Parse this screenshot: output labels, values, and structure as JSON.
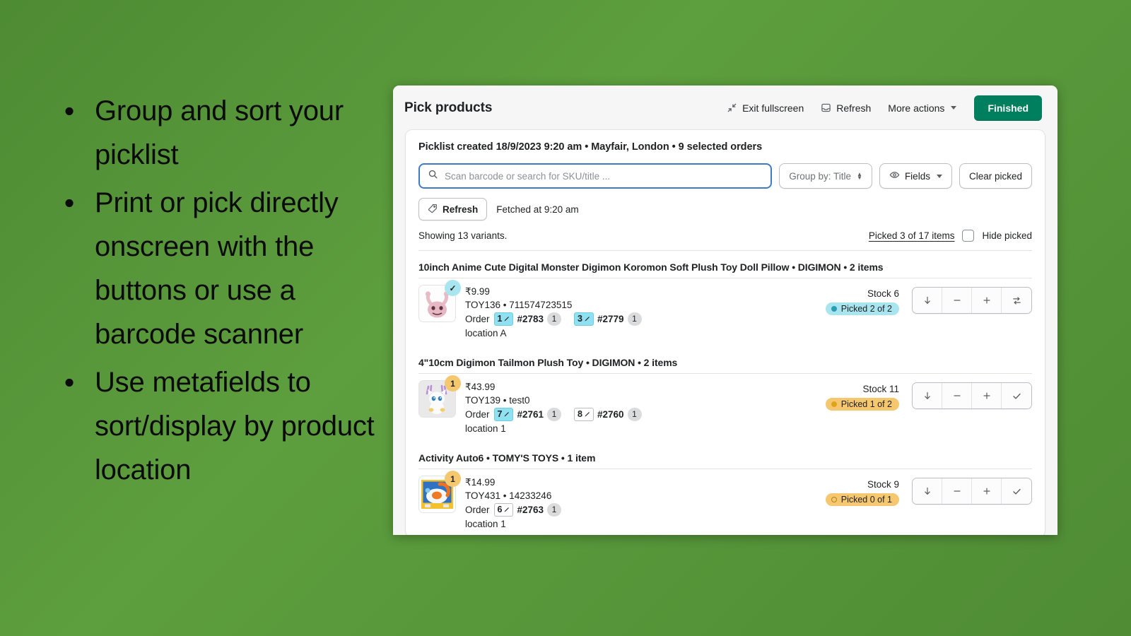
{
  "slide": {
    "bullets": [
      "Group and sort your picklist",
      "Print or pick directly onscreen with the buttons or use a barcode scanner",
      "Use metafields to sort/display by product location"
    ],
    "bullet_marker": "•",
    "background_color": "#55963a"
  },
  "app": {
    "title": "Pick products",
    "header": {
      "exit_fullscreen": "Exit fullscreen",
      "refresh": "Refresh",
      "more_actions": "More actions",
      "finished": "Finished",
      "finished_color": "#007f5f"
    },
    "picklist_meta": "Picklist created 18/9/2023 9:20 am • Mayfair, London • 9 selected orders",
    "search": {
      "placeholder": "Scan barcode or search for SKU/title ...",
      "value": ""
    },
    "group_by": "Group by: Title",
    "fields": "Fields",
    "clear_picked": "Clear picked",
    "refresh_btn": "Refresh",
    "fetched": "Fetched at 9:20 am",
    "showing": "Showing 13 variants.",
    "picked_summary": "Picked 3 of 17 items",
    "hide_picked": "Hide picked",
    "hide_picked_checked": false,
    "groups": [
      {
        "heading": "10inch Anime Cute Digital Monster Digimon Koromon Soft Plush Toy Doll Pillow • DIGIMON • 2 items",
        "rows": [
          {
            "thumb": "koromon",
            "badge": "✓",
            "badge_state": "done",
            "price": "₹9.99",
            "sku": "TOY136 • 711574723515",
            "order_label": "Order",
            "orders": [
              {
                "seq": "1",
                "highlighted": true,
                "number": "#2783",
                "qty": "1"
              },
              {
                "seq": "3",
                "highlighted": true,
                "number": "#2779",
                "qty": "1"
              }
            ],
            "location": "location A",
            "stock": "Stock 6",
            "picked": "Picked 2 of 2",
            "picked_state": "complete",
            "actions": [
              "down-arrow",
              "minus",
              "plus",
              "swap"
            ]
          }
        ]
      },
      {
        "heading": "4\"10cm Digimon Tailmon Plush Toy • DIGIMON • 2 items",
        "rows": [
          {
            "thumb": "tailmon",
            "badge": "1",
            "badge_state": "pending",
            "price": "₹43.99",
            "sku": "TOY139 • test0",
            "order_label": "Order",
            "orders": [
              {
                "seq": "7",
                "highlighted": true,
                "number": "#2761",
                "qty": "1"
              },
              {
                "seq": "8",
                "highlighted": false,
                "number": "#2760",
                "qty": "1"
              }
            ],
            "location": "location 1",
            "stock": "Stock 11",
            "picked": "Picked 1 of 2",
            "picked_state": "partial",
            "actions": [
              "down-arrow",
              "minus",
              "plus",
              "check"
            ]
          }
        ]
      },
      {
        "heading": "Activity Auto6 • TOMY'S TOYS • 1 item",
        "rows": [
          {
            "thumb": "activity-auto",
            "badge": "1",
            "badge_state": "pending",
            "price": "₹14.99",
            "sku": "TOY431 • 14233246",
            "order_label": "Order",
            "orders": [
              {
                "seq": "6",
                "highlighted": false,
                "number": "#2763",
                "qty": "1"
              }
            ],
            "location": "location 1",
            "stock": "Stock 9",
            "picked": "Picked 0 of 1",
            "picked_state": "empty",
            "actions": [
              "down-arrow",
              "minus",
              "plus",
              "check"
            ]
          }
        ]
      }
    ],
    "icons": {
      "search": "search-icon",
      "eye": "eye-icon",
      "tag": "tag-icon",
      "inbox": "inbox-icon",
      "minimize": "exit-fullscreen-icon"
    }
  }
}
